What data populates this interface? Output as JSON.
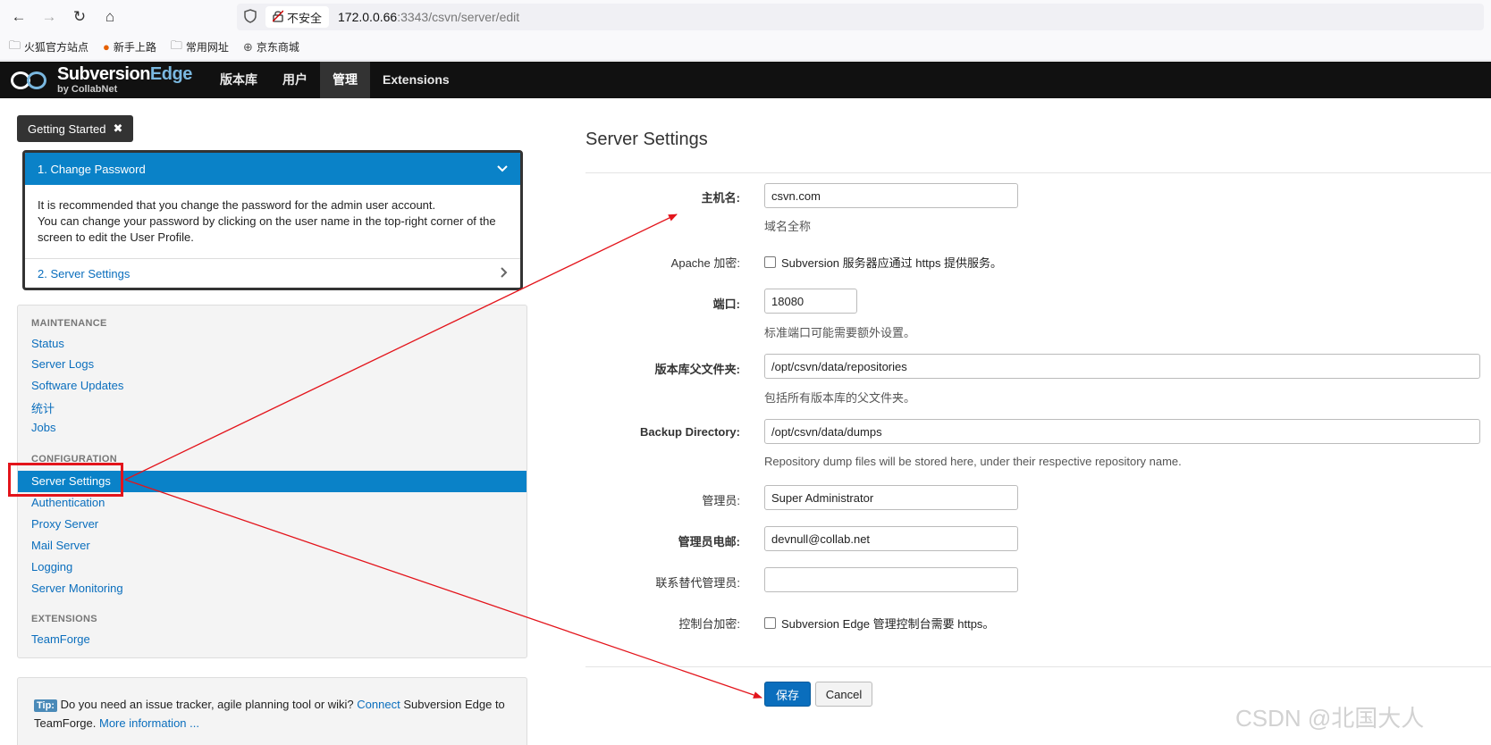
{
  "browser": {
    "back_icon": "←",
    "forward_icon": "→",
    "reload_icon": "↻",
    "home_icon": "⌂",
    "security_label": "不安全",
    "url_host": "172.0.0.66",
    "url_path": ":3343/csvn/server/edit",
    "bookmarks": [
      {
        "label": "火狐官方站点"
      },
      {
        "label": "新手上路"
      },
      {
        "label": "常用网址"
      },
      {
        "label": "京东商城"
      }
    ]
  },
  "app": {
    "logo_main": "Subversion",
    "logo_edge": "Edge",
    "logo_sub": "by CollabNet",
    "nav": [
      {
        "label": "版本库",
        "active": false
      },
      {
        "label": "用户",
        "active": false
      },
      {
        "label": "管理",
        "active": true
      },
      {
        "label": "Extensions",
        "active": false
      }
    ]
  },
  "getting_started": {
    "button_label": "Getting Started",
    "close_icon": "✖",
    "step1_title": "1. Change Password",
    "step1_lines": [
      "It is recommended that you change the password for the admin user account.",
      "You can change your password by clicking on the user name in the top-right corner of the",
      "screen to edit the User Profile."
    ],
    "step2_title": "2. Server Settings"
  },
  "sidebar": {
    "maintenance_title": "MAINTENANCE",
    "maintenance_items": [
      "Status",
      "Server Logs",
      "Software Updates",
      "统计",
      "Jobs"
    ],
    "configuration_title": "CONFIGURATION",
    "configuration_items": [
      "Server Settings",
      "Authentication",
      "Proxy Server",
      "Mail Server",
      "Logging",
      "Server Monitoring"
    ],
    "active_item": "Server Settings",
    "extensions_title": "EXTENSIONS",
    "extensions_items": [
      "TeamForge"
    ]
  },
  "tip": {
    "badge": "Tip:",
    "text_1": " Do you need an issue tracker, agile planning tool or wiki? ",
    "link_connect": "Connect",
    "text_2": " Subversion Edge to",
    "text_3": "TeamForge. ",
    "link_more": "More information ..."
  },
  "form": {
    "title": "Server Settings",
    "hostname_label": "主机名:",
    "hostname_value": "csvn.com",
    "hostname_help": "域名全称",
    "apache_label": "Apache 加密:",
    "apache_checkbox": "Subversion 服务器应通过 https 提供服务。",
    "port_label": "端口:",
    "port_value": "18080",
    "port_help": "标准端口可能需要额外设置。",
    "repo_label": "版本库父文件夹:",
    "repo_value": "/opt/csvn/data/repositories",
    "repo_help": "包括所有版本库的父文件夹。",
    "backup_label": "Backup Directory:",
    "backup_value": "/opt/csvn/data/dumps",
    "backup_help": "Repository dump files will be stored here, under their respective repository name.",
    "admin_label": "管理员:",
    "admin_value": "Super Administrator",
    "admin_email_label": "管理员电邮:",
    "admin_email_value": "devnull@collab.net",
    "alt_admin_label": "联系替代管理员:",
    "alt_admin_value": "",
    "console_label": "控制台加密:",
    "console_checkbox": "Subversion Edge 管理控制台需要 https。",
    "save_label": "保存",
    "cancel_label": "Cancel"
  },
  "annotation": {
    "color": "#e3141b"
  },
  "watermark": "CSDN @北国大人"
}
